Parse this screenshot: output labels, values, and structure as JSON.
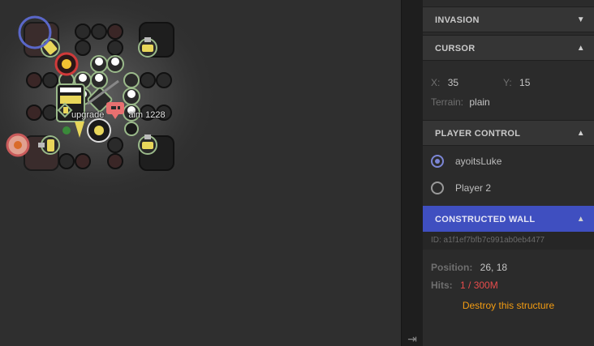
{
  "map": {
    "structure_label": "upgradeController 1228",
    "label_prefix": "upgrade",
    "label_suffix": "aim 1228"
  },
  "panel": {
    "sections": {
      "invasion": {
        "title": "INVASION",
        "expanded": false
      },
      "cursor": {
        "title": "CURSOR",
        "expanded": true
      },
      "player_control": {
        "title": "PLAYER CONTROL",
        "expanded": true
      },
      "constructed_wall": {
        "title": "CONSTRUCTED WALL",
        "expanded": true
      }
    },
    "cursor": {
      "x_label": "X:",
      "x_value": "35",
      "y_label": "Y:",
      "y_value": "15",
      "terrain_label": "Terrain:",
      "terrain_value": "plain"
    },
    "players": [
      {
        "name": "ayoitsLuke",
        "selected": true
      },
      {
        "name": "Player 2",
        "selected": false
      }
    ],
    "wall": {
      "id_text": "ID: a1f1ef7bfb7c991ab0eb4477",
      "position_label": "Position:",
      "position_value": "26, 18",
      "hits_label": "Hits:",
      "hits_value": "1 / 300M",
      "destroy_label": "Destroy this structure"
    }
  },
  "colors": {
    "accent": "#3f4fc0",
    "hits_red": "#e74c4c",
    "destroy_orange": "#f39c12"
  },
  "icons": {
    "collapse": "collapse-panel-icon",
    "chevron_up": "chevron-up-icon",
    "chevron_down": "chevron-down-icon"
  }
}
